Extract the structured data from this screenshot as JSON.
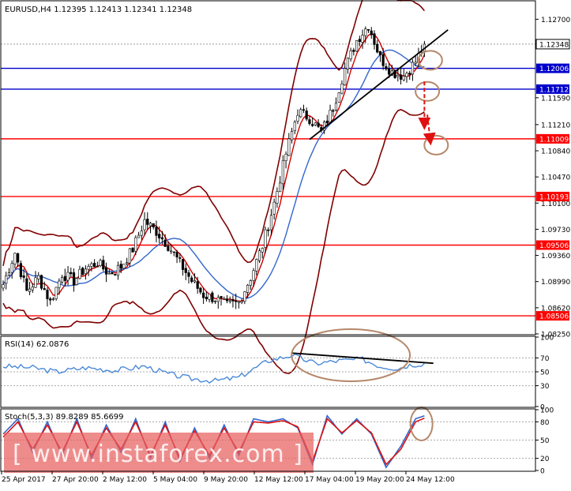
{
  "chart_data": [
    {
      "type": "candlestick",
      "title": "EURUSD,H4  1.12395 1.12413 1.12341 1.12348",
      "ylim": [
        1.0825,
        1.1295
      ],
      "price_ticks": [
        "1.12700",
        "1.11590",
        "1.11210",
        "1.10840",
        "1.10470",
        "1.10100",
        "1.09730",
        "1.09360",
        "1.08990",
        "1.08620",
        "1.08250"
      ],
      "levels": [
        {
          "label": "1.12348",
          "value": 1.12348,
          "color": "#000000",
          "style": "current"
        },
        {
          "label": "1.12006",
          "value": 1.12006,
          "color": "#0000cc"
        },
        {
          "label": "1.11712",
          "value": 1.11712,
          "color": "#0000cc"
        },
        {
          "label": "1.11009",
          "value": 1.11009,
          "color": "#ff0000"
        },
        {
          "label": "1.10193",
          "value": 1.10193,
          "color": "#ff0000"
        },
        {
          "label": "1.09506",
          "value": 1.09506,
          "color": "#ff0000"
        },
        {
          "label": "1.08506",
          "value": 1.08506,
          "color": "#ff0000"
        }
      ],
      "anchors": [
        [
          0,
          1.0895
        ],
        [
          4,
          1.094
        ],
        [
          8,
          1.0885
        ],
        [
          12,
          1.0905
        ],
        [
          16,
          1.087
        ],
        [
          20,
          1.091
        ],
        [
          24,
          1.09
        ],
        [
          28,
          1.0918
        ],
        [
          32,
          1.0925
        ],
        [
          36,
          1.091
        ],
        [
          40,
          1.092
        ],
        [
          44,
          1.0945
        ],
        [
          48,
          1.0985
        ],
        [
          52,
          1.097
        ],
        [
          56,
          1.095
        ],
        [
          60,
          1.0925
        ],
        [
          64,
          1.09
        ],
        [
          68,
          1.088
        ],
        [
          72,
          1.0875
        ],
        [
          76,
          1.0865
        ],
        [
          80,
          1.087
        ],
        [
          84,
          1.0905
        ],
        [
          88,
          1.095
        ],
        [
          92,
          1.101
        ],
        [
          96,
          1.108
        ],
        [
          100,
          1.114
        ],
        [
          104,
          1.113
        ],
        [
          108,
          1.111
        ],
        [
          112,
          1.1145
        ],
        [
          116,
          1.12
        ],
        [
          120,
          1.124
        ],
        [
          124,
          1.1262
        ],
        [
          128,
          1.1215
        ],
        [
          132,
          1.1195
        ],
        [
          136,
          1.119
        ],
        [
          140,
          1.121
        ],
        [
          143,
          1.12348
        ]
      ],
      "candle_count": 144,
      "moving_averages": [
        {
          "period": 5,
          "color": "#cc0000"
        },
        {
          "period": 16,
          "color": "#3366cc"
        }
      ],
      "bollinger": {
        "period": 20,
        "deviation": 2.2,
        "color": "#800000"
      },
      "trendline": {
        "color": "#000000",
        "from": [
          104,
          1.11
        ],
        "to": [
          151,
          1.1255
        ]
      },
      "annotations": [
        {
          "type": "circle",
          "at": [
            145,
            1.1212
          ],
          "color": "#b5886a"
        },
        {
          "type": "circle",
          "at": [
            144,
            1.1168
          ],
          "color": "#b5886a"
        },
        {
          "type": "circle",
          "at": [
            147,
            1.1092
          ],
          "color": "#b5886a"
        },
        {
          "type": "arrow",
          "from": [
            143,
            1.1182
          ],
          "to": [
            143,
            1.112
          ],
          "color": "#e01010"
        },
        {
          "type": "arrow",
          "from": [
            144,
            1.1135
          ],
          "to": [
            145,
            1.1098
          ],
          "color": "#e01010"
        }
      ]
    },
    {
      "type": "line",
      "title": "RSI(14) 62.0876",
      "ylim": [
        0,
        100
      ],
      "levels": [
        70,
        50,
        30
      ],
      "ticks": [
        "100",
        "70",
        "50",
        "30",
        "0"
      ],
      "color": "#4a8ad8",
      "anchors": [
        [
          0,
          58
        ],
        [
          10,
          56
        ],
        [
          18,
          50
        ],
        [
          28,
          56
        ],
        [
          38,
          52
        ],
        [
          48,
          58
        ],
        [
          56,
          47
        ],
        [
          64,
          40
        ],
        [
          72,
          37
        ],
        [
          80,
          42
        ],
        [
          90,
          66
        ],
        [
          98,
          74
        ],
        [
          106,
          62
        ],
        [
          114,
          66
        ],
        [
          122,
          68
        ],
        [
          128,
          58
        ],
        [
          134,
          55
        ],
        [
          138,
          60
        ],
        [
          143,
          62
        ]
      ],
      "divergence_line": {
        "from": [
          98,
          77
        ],
        "to": [
          138,
          60
        ],
        "color": "#000000"
      },
      "annotation": {
        "type": "ellipse",
        "color": "#b5886a"
      }
    },
    {
      "type": "line",
      "title": "Stoch(5,3,3) 89.8289 85.6699",
      "ylim": [
        0,
        100
      ],
      "levels": [
        80,
        50,
        20
      ],
      "ticks": [
        "100",
        "80",
        "50",
        "20",
        "0"
      ],
      "series": [
        {
          "name": "",
          "color": "#3366cc",
          "anchors": [
            [
              0,
              60
            ],
            [
              5,
              85
            ],
            [
              10,
              30
            ],
            [
              15,
              80
            ],
            [
              20,
              25
            ],
            [
              25,
              85
            ],
            [
              30,
              20
            ],
            [
              35,
              75
            ],
            [
              40,
              30
            ],
            [
              45,
              85
            ],
            [
              50,
              20
            ],
            [
              55,
              80
            ],
            [
              60,
              15
            ],
            [
              65,
              70
            ],
            [
              70,
              20
            ],
            [
              75,
              75
            ],
            [
              80,
              25
            ],
            [
              85,
              85
            ],
            [
              90,
              80
            ],
            [
              95,
              85
            ],
            [
              100,
              70
            ],
            [
              105,
              10
            ],
            [
              110,
              90
            ],
            [
              115,
              60
            ],
            [
              120,
              85
            ],
            [
              125,
              60
            ],
            [
              130,
              5
            ],
            [
              135,
              40
            ],
            [
              140,
              85
            ],
            [
              143,
              90
            ]
          ]
        },
        {
          "name": "",
          "color": "#dd1111",
          "anchors": [
            [
              0,
              55
            ],
            [
              5,
              80
            ],
            [
              10,
              35
            ],
            [
              15,
              75
            ],
            [
              20,
              30
            ],
            [
              25,
              80
            ],
            [
              30,
              25
            ],
            [
              35,
              70
            ],
            [
              40,
              35
            ],
            [
              45,
              80
            ],
            [
              50,
              25
            ],
            [
              55,
              75
            ],
            [
              60,
              20
            ],
            [
              65,
              65
            ],
            [
              70,
              25
            ],
            [
              75,
              70
            ],
            [
              80,
              30
            ],
            [
              85,
              80
            ],
            [
              90,
              78
            ],
            [
              95,
              82
            ],
            [
              100,
              72
            ],
            [
              105,
              15
            ],
            [
              110,
              85
            ],
            [
              115,
              62
            ],
            [
              120,
              82
            ],
            [
              125,
              62
            ],
            [
              130,
              10
            ],
            [
              135,
              35
            ],
            [
              140,
              80
            ],
            [
              143,
              86
            ]
          ]
        }
      ],
      "annotation": {
        "type": "ellipse",
        "color": "#b5886a"
      }
    }
  ],
  "time_axis": [
    "25 Apr 2017",
    "27 Apr 20:00",
    "2 May 12:00",
    "5 May 04:00",
    "9 May 20:00",
    "12 May 12:00",
    "17 May 04:00",
    "19 May 20:00",
    "24 May 12:00"
  ],
  "watermark": "[ www.instaforex.com ]"
}
